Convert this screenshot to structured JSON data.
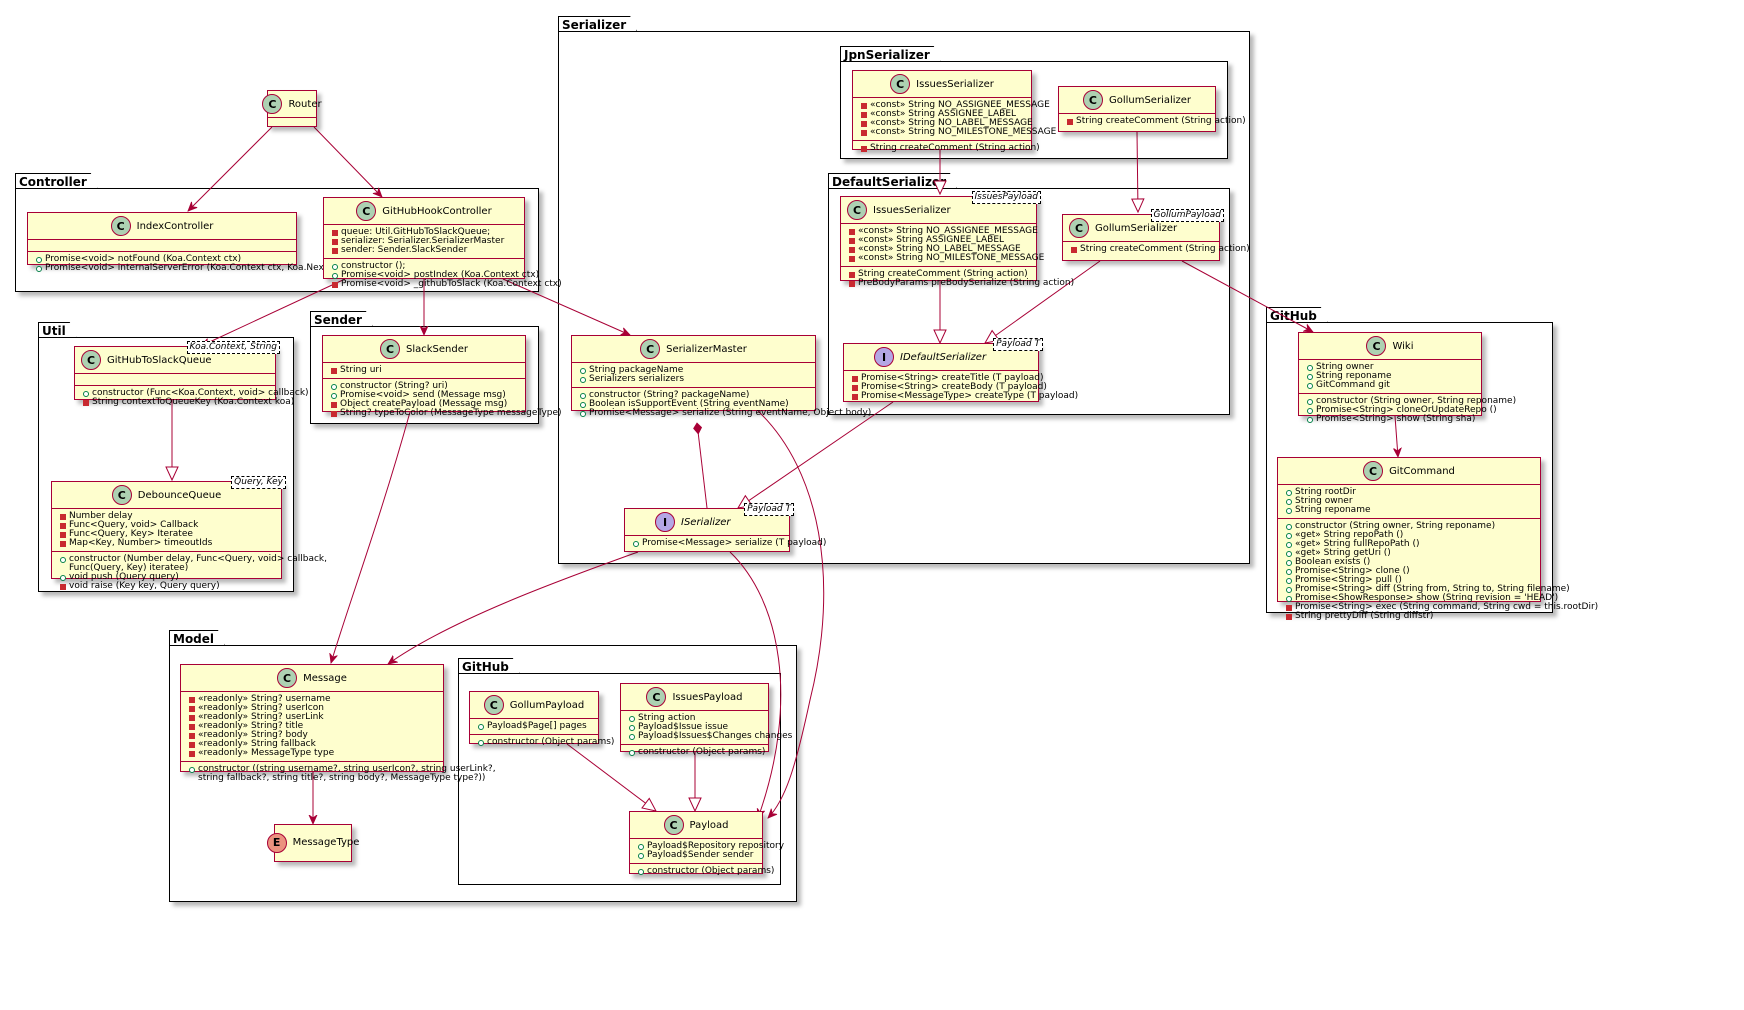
{
  "packages": {
    "controller": "Controller",
    "util": "Util",
    "sender": "Sender",
    "serializer": "Serializer",
    "jpn": "JpnSerializer",
    "default": "DefaultSerializer",
    "github": "GitHub",
    "model": "Model",
    "model_github": "GitHub"
  },
  "classes": {
    "router": {
      "name": "Router"
    },
    "index_controller": {
      "name": "IndexController",
      "methods": [
        "Promise<void> notFound (Koa.Context ctx)",
        "Promise<void> internalServerError (Koa.Context ctx, Koa.Next next)"
      ]
    },
    "github_hook_controller": {
      "name": "GitHubHookController",
      "fields": [
        "queue: Util.GitHubToSlackQueue;",
        "serializer: Serializer.SerializerMaster",
        "sender: Sender.SlackSender"
      ],
      "methods": [
        "constructor ();",
        "Promise<void> postIndex (Koa.Context ctx)",
        "Promise<void> _githubToSlack (Koa.Context ctx)"
      ]
    },
    "github_to_slack_queue": {
      "name": "GitHubToSlackQueue",
      "generic": "Koa.Context, String",
      "methods": [
        "constructor (Func<Koa.Context, void> callback)",
        "String contextToQueueKey (Koa.Context koa)"
      ]
    },
    "debounce_queue": {
      "name": "DebounceQueue",
      "generic": "Query, Key",
      "fields": [
        "Number delay",
        "Func<Query, void> Callback",
        "Func<Query, Key> Iteratee",
        "Map<Key, Number> timeoutIds"
      ],
      "methods": [
        "constructor (Number delay, Func<Query, void> callback,",
        "Func(Query, Key) iteratee)",
        "void push (Query query)",
        "void raise (Key key, Query query)"
      ]
    },
    "slack_sender": {
      "name": "SlackSender",
      "fields": [
        "String uri"
      ],
      "methods": [
        "constructor (String? uri)",
        "Promise<void> send (Message msg)",
        "Object createPayload (Message msg)",
        "String? typeToColor (MessageType messageType)"
      ]
    },
    "serializer_master": {
      "name": "SerializerMaster",
      "fields": [
        "String packageName",
        "Serializers serializers"
      ],
      "methods": [
        "constructor (String? packageName)",
        "Boolean isSupportEvent (String eventName)",
        "Promise<Message> serialize (String eventName, Object body)"
      ]
    },
    "iserializer": {
      "name": "ISerializer",
      "generic": "Payload T",
      "methods": [
        "Promise<Message> serialize (T payload)"
      ]
    },
    "jpn_issues_serializer": {
      "name": "IssuesSerializer",
      "fields": [
        "«const» String NO_ASSIGNEE_MESSAGE",
        "«const» String ASSIGNEE_LABEL",
        "«const» String NO_LABEL_MESSAGE",
        "«const» String NO_MILESTONE_MESSAGE"
      ],
      "methods": [
        "String createComment (String action)"
      ]
    },
    "jpn_gollum_serializer": {
      "name": "GollumSerializer",
      "methods": [
        "String createComment (String action)"
      ]
    },
    "def_issues_serializer": {
      "name": "IssuesSerializer",
      "generic": "IssuesPayload",
      "fields": [
        "«const» String NO_ASSIGNEE_MESSAGE",
        "«const» String ASSIGNEE_LABEL",
        "«const» String NO_LABEL_MESSAGE",
        "«const» String NO_MILESTONE_MESSAGE"
      ],
      "methods": [
        "String createComment (String action)",
        "PreBodyParams preBodySerialize (String action)"
      ]
    },
    "def_gollum_serializer": {
      "name": "GollumSerializer",
      "generic": "GollumPayload",
      "methods": [
        "String createComment (String action)"
      ]
    },
    "idefault_serializer": {
      "name": "IDefaultSerializer",
      "generic": "Payload T",
      "methods": [
        "Promise<String> createTitle (T payload)",
        "Promise<String> createBody (T payload)",
        "Promise<MessageType> createType (T payload)"
      ]
    },
    "wiki": {
      "name": "Wiki",
      "fields": [
        "String owner",
        "String reponame",
        "GitCommand git"
      ],
      "methods": [
        "constructor (String owner, String reponame)",
        "Promise<String> cloneOrUpdateRepo ()",
        "Promise<String> show (String sha)"
      ]
    },
    "git_command": {
      "name": "GitCommand",
      "fields": [
        "String rootDir",
        "String owner",
        "String reponame"
      ],
      "methods": [
        "constructor (String owner, String reponame)",
        "«get» String repoPath ()",
        "«get» String fullRepoPath ()",
        "«get» String getUri ()",
        "Boolean exists ()",
        "Promise<String> clone ()",
        "Promise<String> pull ()",
        "Promise<String> diff (String from, String to, String filename)",
        "Promise<ShowResponse> show (String revision = 'HEAD')",
        "Promise<String> exec (String command, String cwd = this.rootDir)",
        "String prettyDiff (String diffstr)"
      ]
    },
    "message": {
      "name": "Message",
      "fields": [
        "«readonly» String? username",
        "«readonly» String? userIcon",
        "«readonly» String? userLink",
        "«readonly» String? title",
        "«readonly» String? body",
        "«readonly» String fallback",
        "«readonly» MessageType type"
      ],
      "methods": [
        "constructor ((string username?, string userIcon?, string userLink?,",
        "string fallback?, string title?, string body?, MessageType type?))"
      ]
    },
    "message_type": {
      "name": "MessageType"
    },
    "gollum_payload": {
      "name": "GollumPayload",
      "fields": [
        "Payload$Page[] pages"
      ],
      "methods": [
        "constructor (Object params)"
      ]
    },
    "issues_payload": {
      "name": "IssuesPayload",
      "fields": [
        "String action",
        "Payload$Issue issue",
        "Payload$Issues$Changes changes"
      ],
      "methods": [
        "constructor (Object params)"
      ]
    },
    "payload": {
      "name": "Payload",
      "fields": [
        "Payload$Repository repository",
        "Payload$Sender sender"
      ],
      "methods": [
        "constructor (Object params)"
      ]
    }
  },
  "colors": {
    "class_fill": "#fefece",
    "class_border": "#a80036",
    "edge": "#a80036",
    "badge_class": "#add1b2",
    "badge_interface": "#b4a7e5",
    "badge_enum": "#eb937f",
    "public": "#038048",
    "private": "#c82930"
  }
}
